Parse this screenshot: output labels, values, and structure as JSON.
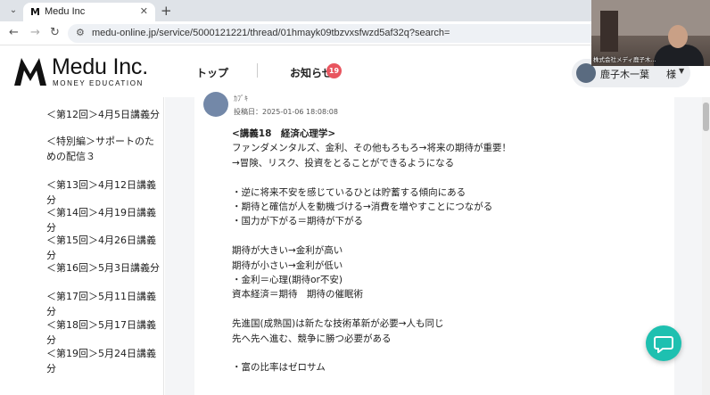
{
  "browser": {
    "tab_title": "Medu Inc",
    "tab_logo": "M",
    "url": "medu-online.jp/service/5000121221/thread/01hmayk09tbzvxsfwzd5af32q?search="
  },
  "header": {
    "logo_text": "Medu Inc.",
    "logo_sub": "MONEY EDUCATION",
    "nav_top": "トップ",
    "nav_news": "お知らせ",
    "news_count": "19",
    "user_name": "鹿子木一葉",
    "user_suffix": "様"
  },
  "video": {
    "label": "株式会社メディ鹿子木..."
  },
  "sidebar": {
    "items": [
      "＜第12回＞4月5日講義分",
      "＜特別編＞サポートのための配信３",
      "＜第13回＞4月12日講義分",
      "＜第14回＞4月19日講義分",
      "＜第15回＞4月26日講義分",
      "＜第16回＞5月3日講義分",
      "＜第17回＞5月11日講義分",
      "＜第18回＞5月17日講義分",
      "＜第19回＞5月24日講義分"
    ]
  },
  "post": {
    "author": "ｶﾌﾞｷ",
    "date": "投稿日：2025-01-06 18:08:08",
    "lines": [
      "<講義18　経済心理学>",
      "ファンダメンタルズ、金利、その他もろもろ→将来の期待が重要！",
      "→冒険、リスク、投資をとることができるようになる",
      "・逆に将来不安を感じているひとは貯蓄する傾向にある",
      "・期待と確信が人を動機づける→消費を増やすことにつながる",
      "・国力が下がる＝期待が下がる",
      "期待が大きい→金利が高い",
      "期待が小さい→金利が低い",
      "・金利＝心理(期待or不安)",
      "資本経済＝期待　期待の催眠術",
      "先進国(成熟国)は新たな技術革新が必要→人も同じ",
      "先へ先へ進む、競争に勝つ必要がある",
      "・富の比率はゼロサム"
    ]
  },
  "colors": {
    "accent": "#1ec0b0",
    "badge": "#e8555f"
  },
  "icons": {
    "chat": "chat-bubble-icon"
  }
}
